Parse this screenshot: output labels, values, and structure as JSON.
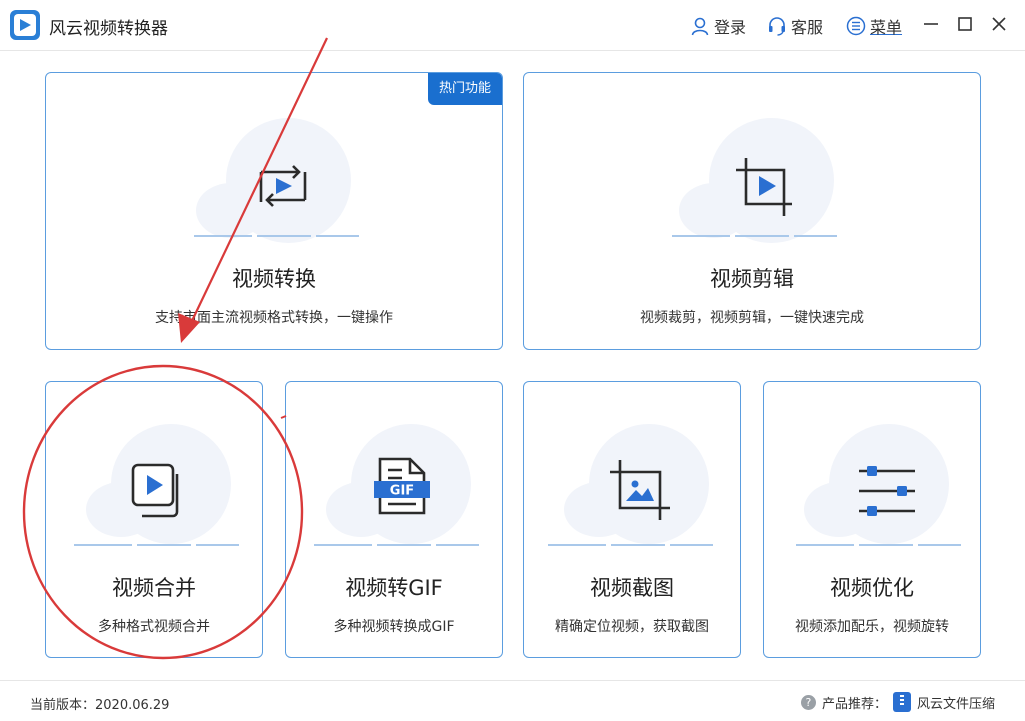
{
  "app": {
    "title": "风云视频转换器"
  },
  "toolbar": {
    "login_label": "登录",
    "service_label": "客服",
    "menu_label": "菜单"
  },
  "cards": {
    "convert": {
      "badge": "热门功能",
      "title": "视频转换",
      "desc": "支持市面主流视频格式转换，一键操作"
    },
    "edit": {
      "title": "视频剪辑",
      "desc": "视频裁剪，视频剪辑，一键快速完成"
    },
    "merge": {
      "title": "视频合并",
      "desc": "多种格式视频合并"
    },
    "gif": {
      "title": "视频转GIF",
      "desc": "多种视频转换成GIF",
      "icon_text": "GIF"
    },
    "screenshot": {
      "title": "视频截图",
      "desc": "精确定位视频，获取截图"
    },
    "optimize": {
      "title": "视频优化",
      "desc": "视频添加配乐，视频旋转"
    }
  },
  "footer": {
    "version_label": "当前版本：2020.06.29",
    "recommend_label": "产品推荐：",
    "recommend_product": "风云文件压缩"
  },
  "colors": {
    "accent": "#1a6fcf",
    "card_border": "#5b9ddf",
    "annotation": "#d93a3a"
  },
  "icons": [
    "app-logo-icon",
    "user-icon",
    "headset-icon",
    "menu-list-icon",
    "minimize-icon",
    "maximize-icon",
    "close-icon",
    "video-convert-icon",
    "crop-icon",
    "video-merge-icon",
    "gif-file-icon",
    "image-crop-icon",
    "sliders-icon",
    "help-icon",
    "zip-icon"
  ]
}
